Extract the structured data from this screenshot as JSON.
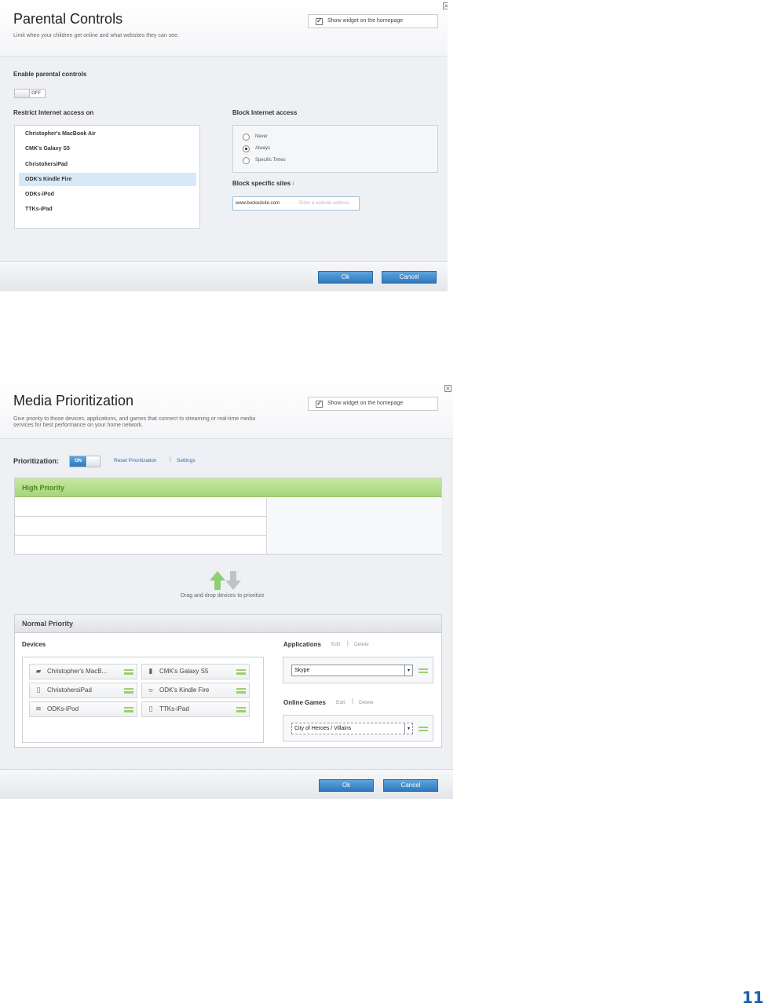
{
  "parental": {
    "title": "Parental Controls",
    "subtitle": "Limit when your children get online and what websites they can see.",
    "show_widget": "Show widget on the homepage",
    "enable_label": "Enable parental controls",
    "toggle_state": "OFF",
    "restrict_label": "Restrict Internet access on",
    "devices": [
      "Christopher's MacBook Air",
      "CMK's Galaxy S5",
      "ChristohersiPad",
      "ODK's Kindle Fire",
      "ODKs-iPod",
      "TTKs-iPad"
    ],
    "selected_device": "ODK's Kindle Fire",
    "block_label": "Block Internet access",
    "block_options": [
      "Never",
      "Always",
      "Specific Times"
    ],
    "block_selected": "Always",
    "sites_label": "Block specific sites",
    "site_value": "www.bockedsite.com",
    "site_placeholder": "Enter a website address",
    "ok": "Ok",
    "cancel": "Cancel"
  },
  "media": {
    "title": "Media Prioritization",
    "subtitle_line1": "Give priority to those devices, applications, and games that connect to streaming or real-time media",
    "subtitle_line2": "services for best performance on your home network.",
    "show_widget": "Show widget on the homepage",
    "prioritization_label": "Prioritization:",
    "toggle_state": "ON",
    "reset_link": "Reset Prioritization",
    "settings_link": "Settings",
    "separator": "|",
    "high_priority": "High Priority",
    "drag_hint": "Drag and drop devices to prioritize",
    "normal_priority": "Normal Priority",
    "devices_label": "Devices",
    "devices": [
      {
        "name": "Christopher's MacB...",
        "icon": "laptop-icon"
      },
      {
        "name": "CMK's Galaxy S5",
        "icon": "phone-icon"
      },
      {
        "name": "ChristohersiPad",
        "icon": "tablet-icon"
      },
      {
        "name": "ODK's Kindle Fire",
        "icon": "wireless-icon"
      },
      {
        "name": "ODKs-iPod",
        "icon": "ipod-icon"
      },
      {
        "name": "TTKs-iPad",
        "icon": "tablet-icon"
      }
    ],
    "applications_label": "Applications",
    "edit": "Edit",
    "delete": "Delete",
    "application_value": "Skype",
    "online_games_label": "Online Games",
    "game_value": "City of Heroes / Villains",
    "ok": "Ok",
    "cancel": "Cancel"
  },
  "page_number": "11",
  "colors": {
    "accent": "#2f78bc",
    "high_priority": "#a7d47c",
    "page_number": "#1f5fb0"
  }
}
